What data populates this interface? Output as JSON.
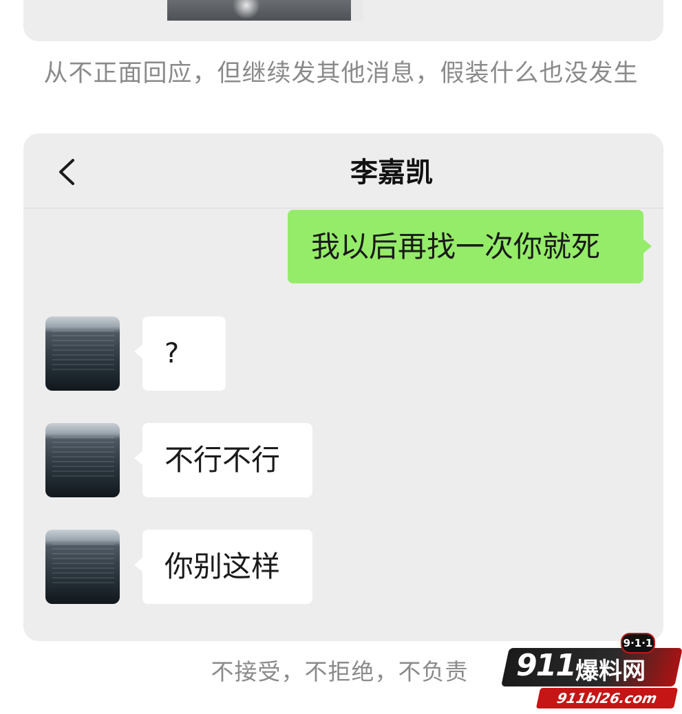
{
  "captions": {
    "top": "从不正面回应，但继续发其他消息，假装什么也没发生",
    "bottom": "不接受，不拒绝，不负责"
  },
  "chat": {
    "title": "李嘉凯",
    "back_icon": "chevron-left-icon",
    "messages": [
      {
        "from": "me",
        "text": "我以后再找一次你就死"
      },
      {
        "from": "other",
        "text": "?"
      },
      {
        "from": "other",
        "text": "不行不行"
      },
      {
        "from": "other",
        "text": "你别这样"
      }
    ]
  },
  "watermark": {
    "badge": "9·1·1",
    "number": "911",
    "name": "爆料网",
    "url": "911bl26.com"
  },
  "colors": {
    "sent_bubble": "#95ec69",
    "received_bubble": "#ffffff",
    "chat_background": "#ededed",
    "caption_text": "#8a8a8a",
    "watermark_red": "#c61515"
  }
}
